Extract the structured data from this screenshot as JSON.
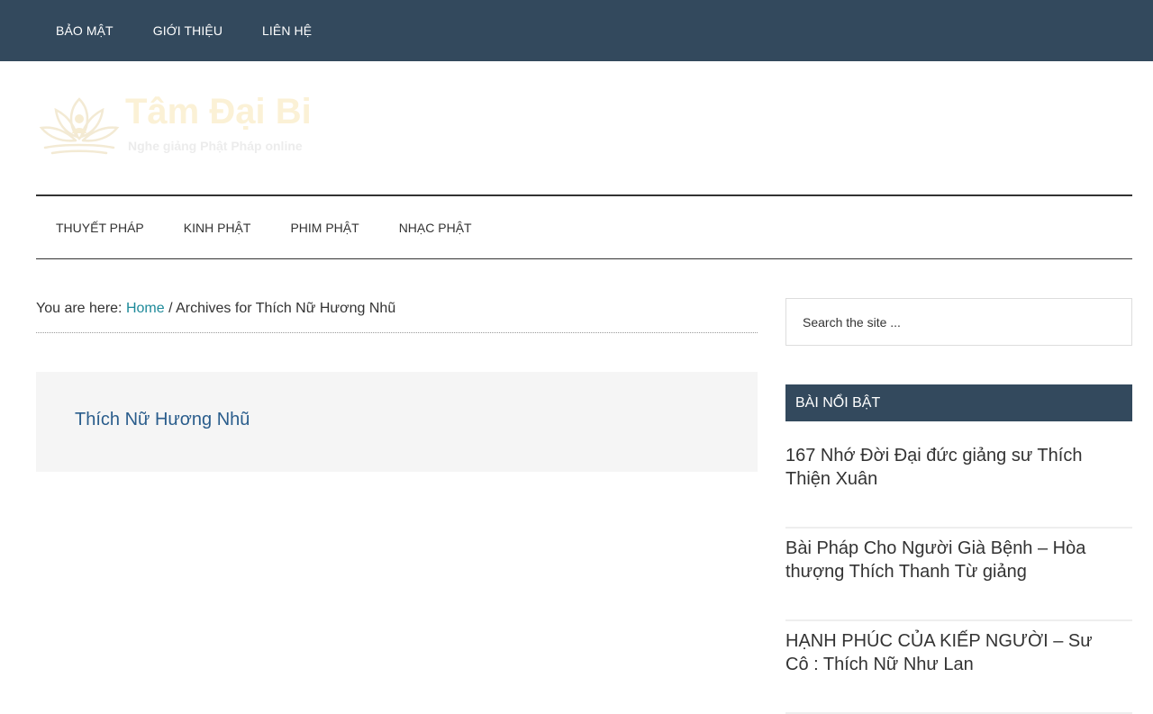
{
  "top_nav": {
    "items": [
      {
        "label": "BẢO MẬT"
      },
      {
        "label": "GIỚI THIỆU"
      },
      {
        "label": "LIÊN HỆ"
      }
    ]
  },
  "header": {
    "site_title": "Tâm Đại Bi",
    "tagline": "Nghe giảng Phật Pháp online",
    "logo_icon": "lotus-icon"
  },
  "main_nav": {
    "items": [
      {
        "label": "THUYẾT PHÁP"
      },
      {
        "label": "KINH PHẬT"
      },
      {
        "label": "PHIM PHẬT"
      },
      {
        "label": "NHẠC PHẬT"
      }
    ]
  },
  "breadcrumb": {
    "prefix": "You are here: ",
    "home_label": "Home",
    "separator": " / ",
    "current": "Archives for Thích Nữ Hương Nhũ"
  },
  "archive": {
    "title": "Thích Nữ Hương Nhũ"
  },
  "sidebar": {
    "search_placeholder": "Search the site ...",
    "featured_title": "BÀI NỔI BẬT",
    "featured_posts": [
      {
        "title": "167 Nhớ Đời Đại đức giảng sư Thích Thiện Xuân"
      },
      {
        "title": "Bài Pháp Cho Người Già Bệnh – Hòa thượng Thích Thanh Từ giảng"
      },
      {
        "title": "HẠNH PHÚC CỦA KIẾP NGƯỜI – Sư Cô : Thích Nữ Như Lan"
      }
    ]
  },
  "colors": {
    "top_bar": "#33495d",
    "link": "#1e8a9a",
    "archive_title": "#2a5d8c",
    "archive_bg": "#f5f5f5",
    "logo_text": "#fbf1d6"
  }
}
